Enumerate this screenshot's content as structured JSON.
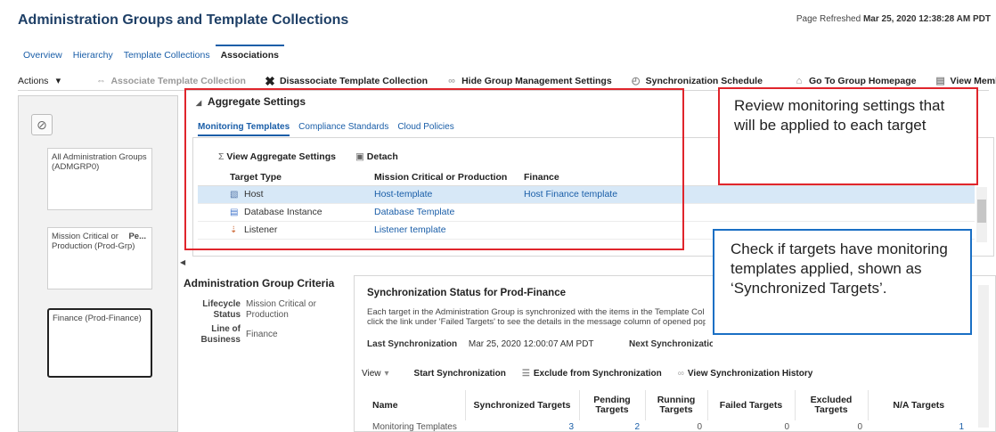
{
  "header": {
    "title": "Administration Groups and Template Collections",
    "refresh_label": "Page Refreshed",
    "refresh_time": "Mar 25, 2020 12:38:28 AM PDT"
  },
  "tabs": [
    {
      "label": "Overview"
    },
    {
      "label": "Hierarchy"
    },
    {
      "label": "Template Collections"
    },
    {
      "label": "Associations",
      "active": true
    }
  ],
  "toolbar": {
    "actions": "Actions",
    "associate": "Associate Template Collection",
    "disassociate": "Disassociate Template Collection",
    "hide_settings": "Hide Group Management Settings",
    "sync_schedule": "Synchronization Schedule",
    "go_home": "Go To Group Homepage",
    "view_members": "View Members"
  },
  "hierarchy": {
    "nodes": [
      {
        "label": "All Administration Groups (ADMGRP0)"
      },
      {
        "label": "Mission Critical or Production (Prod-Grp)",
        "extra": "Pe..."
      },
      {
        "label": "Finance (Prod-Finance)",
        "selected": true
      }
    ]
  },
  "aggregate": {
    "title": "Aggregate Settings",
    "tabs": [
      {
        "label": "Monitoring Templates",
        "active": true
      },
      {
        "label": "Compliance Standards"
      },
      {
        "label": "Cloud Policies"
      }
    ],
    "view_settings": "View Aggregate Settings",
    "detach": "Detach",
    "columns": [
      "Target Type",
      "Mission Critical or Production",
      "Finance"
    ],
    "rows": [
      {
        "type": "Host",
        "icon": "host-icon",
        "mcp": "Host-template",
        "finance": "Host Finance template",
        "selected": true
      },
      {
        "type": "Database Instance",
        "icon": "database-icon",
        "mcp": "Database Template",
        "finance": ""
      },
      {
        "type": "Listener",
        "icon": "listener-icon",
        "mcp": "Listener template",
        "finance": ""
      }
    ]
  },
  "criteria": {
    "title": "Administration Group Criteria",
    "rows": [
      {
        "key": "Lifecycle Status",
        "value": "Mission Critical or Production"
      },
      {
        "key": "Line of Business",
        "value": "Finance"
      }
    ]
  },
  "sync": {
    "title": "Synchronization Status for Prod-Finance",
    "desc_line1": "Each target in the Administration Group is synchronized with the items in the Template Col",
    "desc_line2": "click the link under 'Failed Targets' to see the details in the message column of opened pop",
    "last_label": "Last Synchronization",
    "last_value": "Mar 25, 2020 12:00:07 AM PDT",
    "next_label": "Next Synchronizatio",
    "view": "View",
    "start": "Start Synchronization",
    "exclude": "Exclude from Synchronization",
    "history": "View Synchronization History",
    "columns": [
      "Name",
      "Synchronized Targets",
      "Pending Targets",
      "Running Targets",
      "Failed Targets",
      "Excluded Targets",
      "N/A Targets"
    ],
    "rows": [
      {
        "name": "Monitoring Templates",
        "synced": "3",
        "pending": "2",
        "running": "0",
        "failed": "0",
        "excluded": "0",
        "na": "1"
      }
    ]
  },
  "callouts": {
    "review": "Review monitoring settings that will be applied to each target",
    "check": "Check if targets have monitoring templates applied, shown as ‘Synchronized Targets’."
  },
  "colors": {
    "accent": "#1a5ea8",
    "highlight_red": "#e0252c",
    "highlight_blue": "#1a6fc4",
    "selected_row": "#d7e8f7"
  }
}
